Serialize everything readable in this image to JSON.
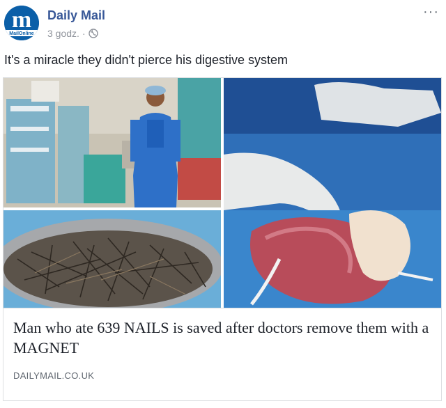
{
  "post": {
    "page_name": "Daily Mail",
    "avatar_letter": "m",
    "avatar_subtext": "MailOnline",
    "time": "3 godz.",
    "separator": "·",
    "more_label": "···",
    "caption": "It's a miracle they didn't pierce his digestive system"
  },
  "link_card": {
    "headline": "Man who ate 639 NAILS is saved after doctors remove them with a MAGNET",
    "domain": "DAILYMAIL.CO.UK"
  },
  "colors": {
    "link_blue": "#385898",
    "avatar_blue": "#0b5fa8",
    "meta_gray": "#90949c"
  }
}
